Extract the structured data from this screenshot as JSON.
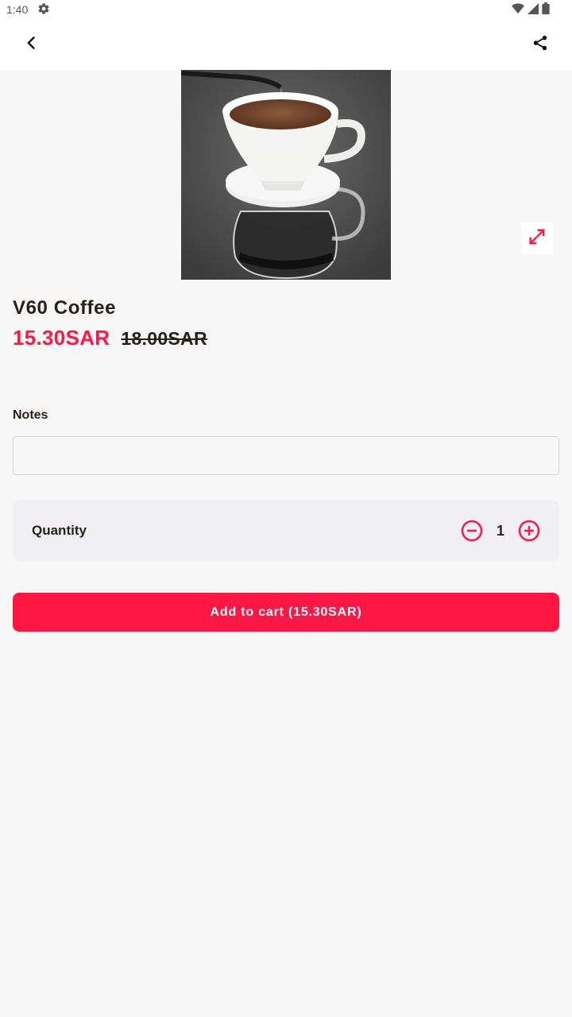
{
  "status_bar": {
    "time": "1:40",
    "icons": [
      "settings-icon",
      "wifi-icon",
      "signal-icon",
      "battery-icon"
    ]
  },
  "app_bar": {
    "back_icon": "chevron-left-icon",
    "share_icon": "share-icon"
  },
  "product": {
    "image": "coffee-pour-over-photo",
    "expand_icon": "expand-icon",
    "name": "V60 Coffee",
    "price": "15.30SAR",
    "original_price": "18.00SAR"
  },
  "notes": {
    "label": "Notes",
    "value": "",
    "placeholder": ""
  },
  "quantity": {
    "label": "Quantity",
    "value": "1",
    "minus_icon": "minus-circle-icon",
    "plus_icon": "plus-circle-icon"
  },
  "cart_button": {
    "label": "Add to cart (15.30SAR)"
  },
  "colors": {
    "accent": "#ff1744",
    "text": "#2a2118",
    "background": "#f7f7f7",
    "card": "#efeff4"
  }
}
